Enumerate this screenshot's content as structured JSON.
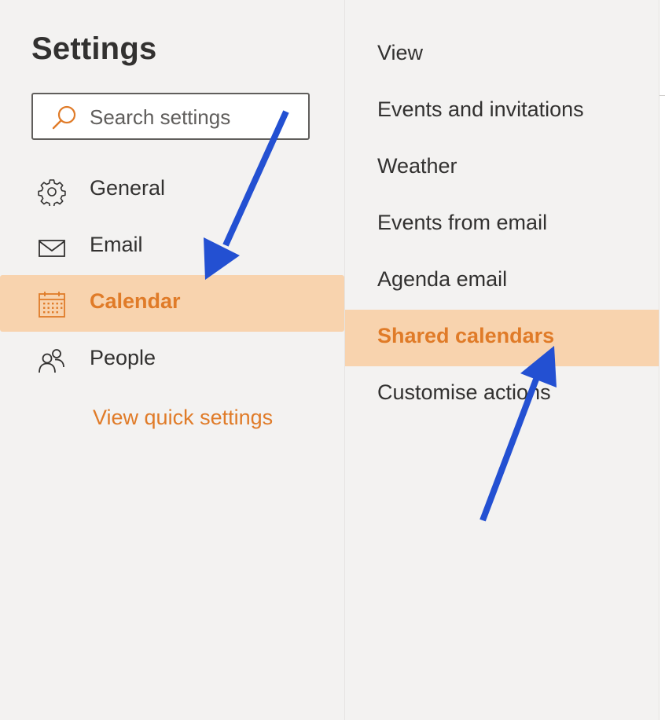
{
  "settings": {
    "title": "Settings",
    "search": {
      "placeholder": "Search settings",
      "value": ""
    },
    "nav": [
      {
        "label": "General",
        "icon": "gear-icon"
      },
      {
        "label": "Email",
        "icon": "mail-icon"
      },
      {
        "label": "Calendar",
        "icon": "calendar-icon",
        "selected": true
      },
      {
        "label": "People",
        "icon": "people-icon"
      }
    ],
    "quick_settings_link": "View quick settings"
  },
  "calendar_settings": {
    "items": [
      {
        "label": "View"
      },
      {
        "label": "Events and invitations"
      },
      {
        "label": "Weather"
      },
      {
        "label": "Events from email"
      },
      {
        "label": "Agenda email"
      },
      {
        "label": "Shared calendars",
        "selected": true
      },
      {
        "label": "Customise actions"
      }
    ]
  },
  "colors": {
    "accent": "#e07b28",
    "selection_bg": "#f8d3ae",
    "pane_bg": "#f3f2f1",
    "annotation_arrow": "#2350d2"
  }
}
